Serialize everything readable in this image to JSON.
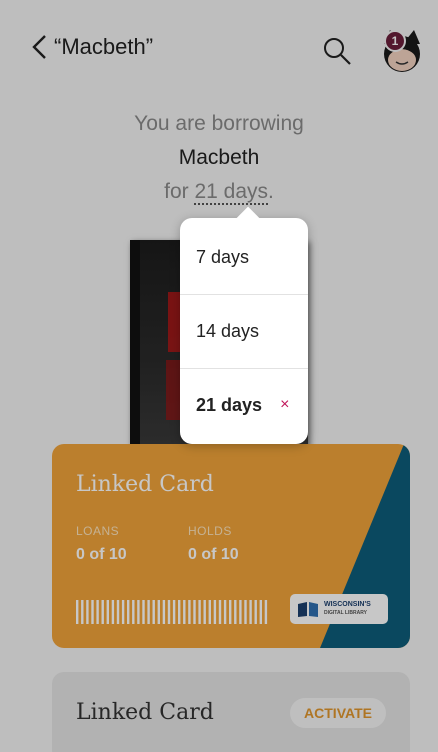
{
  "header": {
    "title": "“Macbeth”",
    "notification_count": "1"
  },
  "borrow": {
    "intro": "You are borrowing",
    "title": "Macbeth",
    "prefix": "for ",
    "period": "21 days",
    "suffix": "."
  },
  "dropdown": {
    "options": [
      {
        "label": "7 days"
      },
      {
        "label": "14 days"
      },
      {
        "label": "21 days",
        "selected": true
      }
    ],
    "clear_symbol": "×"
  },
  "card": {
    "title": "Linked Card",
    "loans_label": "LOANS",
    "loans_value": "0 of 10",
    "holds_label": "HOLDS",
    "holds_value": "0 of 10",
    "library_name": "WISCONSIN'S",
    "library_sub": "DIGITAL LIBRARY",
    "colors": {
      "primary": "#f0a33a",
      "secondary": "#0d5d7a"
    }
  },
  "card2": {
    "title": "Linked Card",
    "activate_label": "ACTIVATE"
  }
}
